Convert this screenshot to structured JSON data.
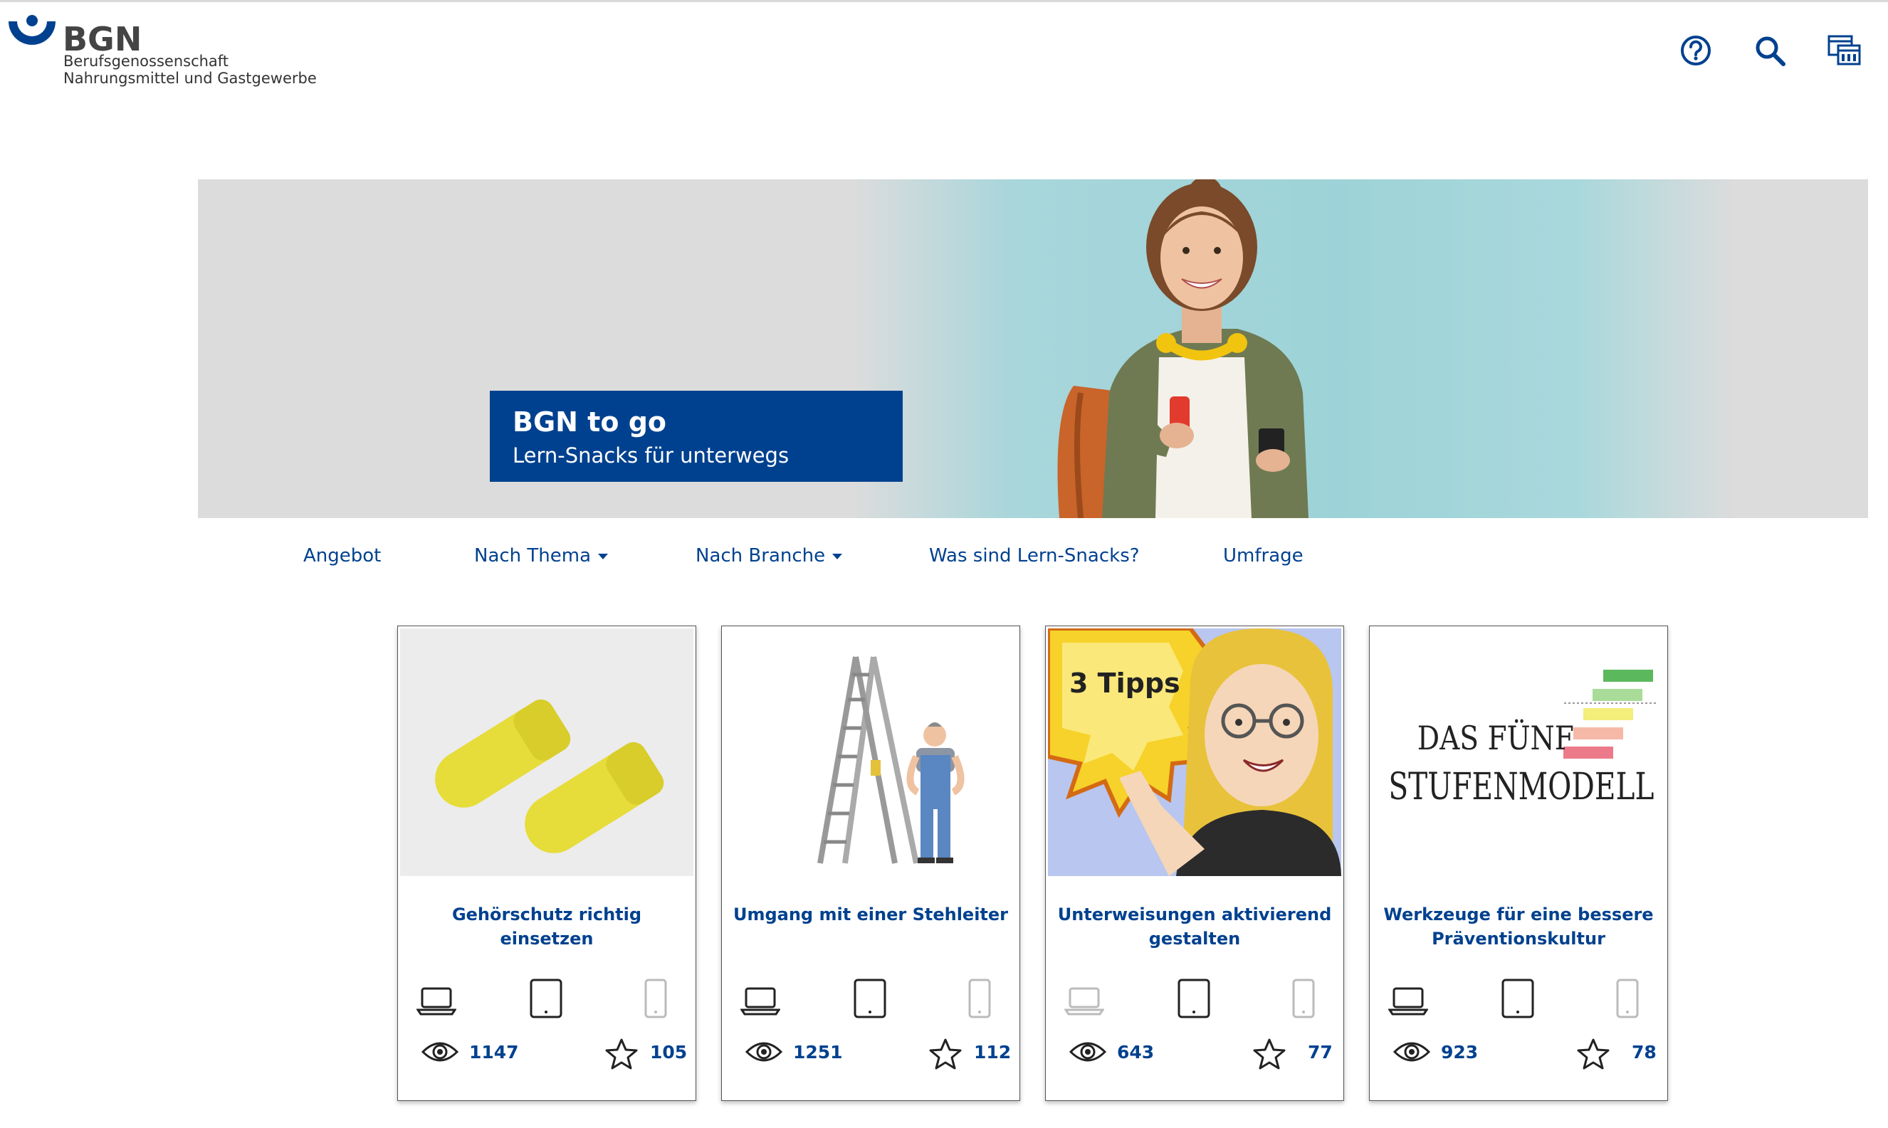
{
  "header": {
    "logo_name": "BGN",
    "logo_line1": "Berufsgenossenschaft",
    "logo_line2": "Nahrungsmittel und Gastgewerbe",
    "icons": [
      "help-icon",
      "search-icon",
      "dashboard-icon"
    ]
  },
  "hero": {
    "title": "BGN to go",
    "subtitle": "Lern-Snacks für unterwegs"
  },
  "nav": [
    {
      "label": "Angebot"
    },
    {
      "label": "Nach Thema",
      "dropdown": true
    },
    {
      "label": "Nach Branche",
      "dropdown": true
    },
    {
      "label": "Was sind Lern-Snacks?"
    },
    {
      "label": "Umfrage"
    }
  ],
  "cards": [
    {
      "title": "Gehörschutz richtig einsetzen",
      "views": "1147",
      "stars": "105",
      "devices": {
        "laptop": true,
        "tablet": true,
        "phone": false
      }
    },
    {
      "title": "Umgang mit einer Stehleiter",
      "views": "1251",
      "stars": "112",
      "devices": {
        "laptop": true,
        "tablet": true,
        "phone": false
      }
    },
    {
      "title": "Unterweisungen aktivierend gestalten",
      "image_text": "3 Tipps",
      "views": "643",
      "stars": "77",
      "devices": {
        "laptop": false,
        "tablet": true,
        "phone": false
      }
    },
    {
      "title": "Werkzeuge für eine bessere Präventionskultur",
      "image_text_1": "DAS FÜNF",
      "image_text_2": "STUFENMODELL",
      "views": "923",
      "stars": "78",
      "devices": {
        "laptop": true,
        "tablet": true,
        "phone": false
      }
    }
  ],
  "colors": {
    "brand": "#00418f",
    "device_active": "#222222",
    "device_inactive": "#bbbbbb"
  }
}
